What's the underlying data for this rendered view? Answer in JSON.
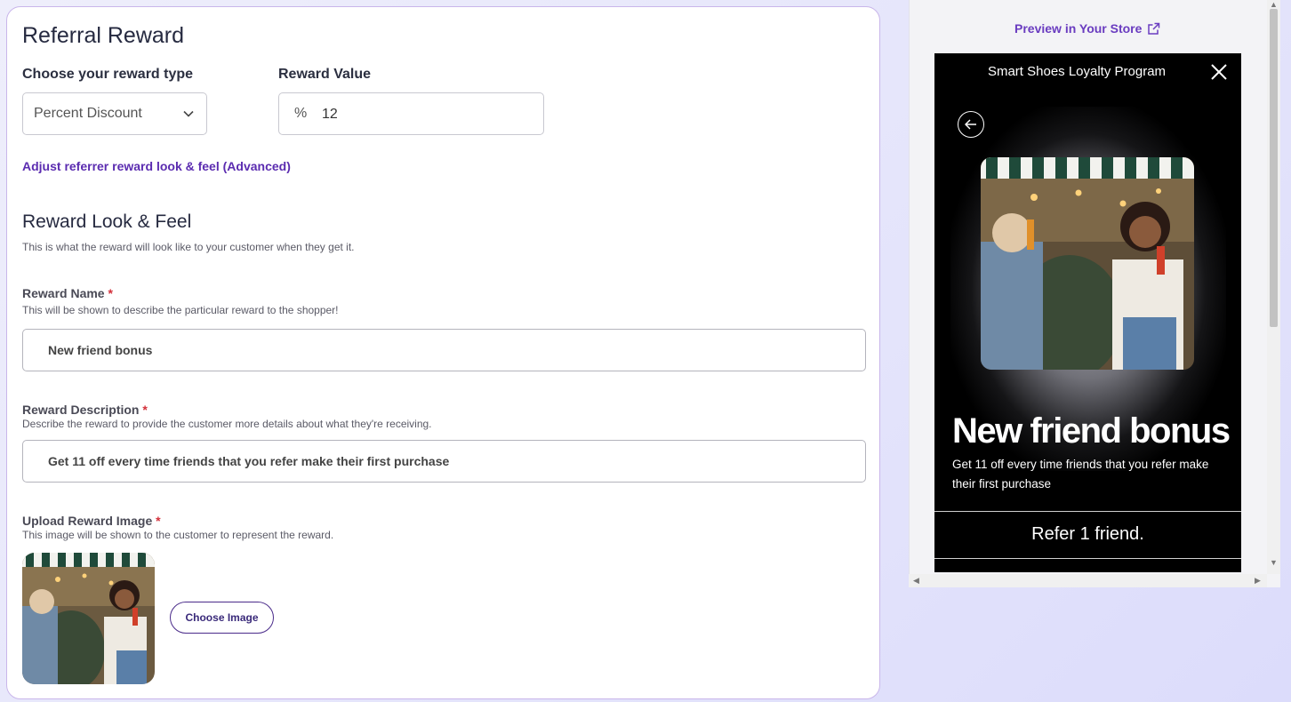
{
  "form": {
    "title": "Referral Reward",
    "reward_type_label": "Choose your reward type",
    "reward_type_value": "Percent Discount",
    "reward_value_label": "Reward Value",
    "reward_value_prefix": "%",
    "reward_value": "12",
    "advanced_link": "Adjust referrer reward look & feel (Advanced)",
    "look_title": "Reward Look & Feel",
    "look_subtitle": "This is what the reward will look like to your customer when they get it.",
    "name_label": "Reward Name",
    "name_help": "This will be shown to describe the particular reward to the shopper!",
    "name_value": "New friend bonus",
    "desc_label": "Reward Description",
    "desc_help": "Describe the reward to provide the customer more details about what they're receiving.",
    "desc_value": "Get 11 off every time friends that you refer make their first purchase",
    "image_label": "Upload Reward Image",
    "image_help": "This image will be shown to the customer to represent the reward.",
    "choose_image_label": "Choose Image",
    "required_mark": "*"
  },
  "preview": {
    "link_label": "Preview in Your Store",
    "program_title": "Smart Shoes Loyalty Program",
    "headline": "New friend bonus",
    "description": "Get 11 off every time friends that you refer make their first purchase",
    "refer_text": "Refer 1 friend."
  },
  "colors": {
    "accent": "#5b2cb0",
    "required": "#d3303a",
    "preview_bg": "#000000"
  },
  "icons": [
    "chevron-down-icon",
    "external-link-icon",
    "close-icon",
    "back-arrow-icon"
  ]
}
